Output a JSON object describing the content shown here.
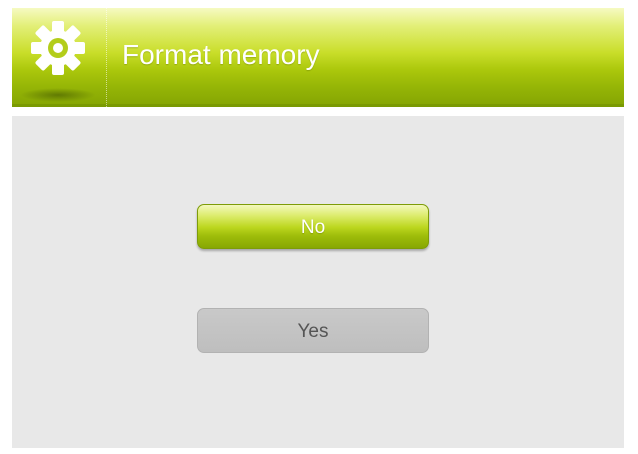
{
  "header": {
    "title": "Format memory",
    "icon": "gear-icon",
    "accent_color": "#a8c612"
  },
  "dialog": {
    "no_label": "No",
    "yes_label": "Yes",
    "selected": "No"
  }
}
